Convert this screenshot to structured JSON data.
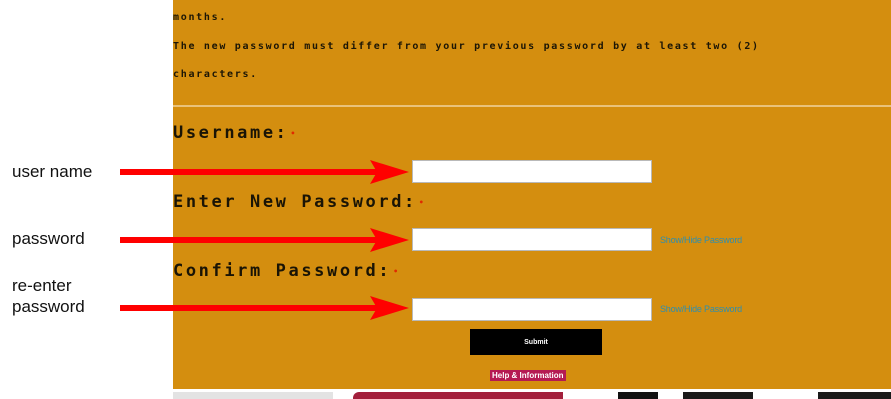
{
  "instructions": {
    "line1": "months.",
    "line2": "The new password must differ from your previous password by at least two (2)",
    "line3": "characters."
  },
  "form": {
    "username_label": "Username:",
    "new_password_label": "Enter New Password:",
    "confirm_password_label": "Confirm Password:",
    "required_marker": "•",
    "username_value": "",
    "new_password_value": "",
    "confirm_password_value": "",
    "show_hide_label": "Show/Hide Password",
    "submit_label": "Submit",
    "help_label": "Help & Information"
  },
  "annotations": {
    "user_name": "user name",
    "password": "password",
    "reenter_line1": "re-enter",
    "reenter_line2": "password"
  },
  "colors": {
    "panel_background": "#d48e0f",
    "arrow": "#ff0000",
    "link": "#2d8fb0",
    "help_background": "#b51a52"
  }
}
